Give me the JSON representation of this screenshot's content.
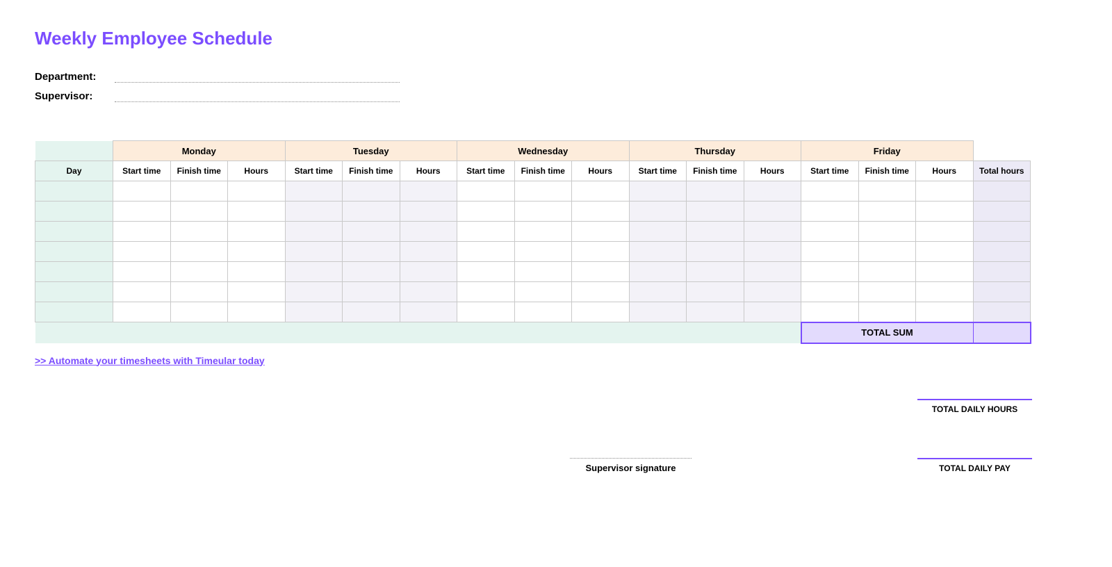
{
  "title": "Weekly Employee Schedule",
  "fields": {
    "department_label": "Department:",
    "supervisor_label": "Supervisor:",
    "department_value": "",
    "supervisor_value": ""
  },
  "table": {
    "day_header": "Day",
    "days": [
      "Monday",
      "Tuesday",
      "Wednesday",
      "Thursday",
      "Friday"
    ],
    "sub_headers": [
      "Start time",
      "Finish time",
      "Hours"
    ],
    "total_hours_header": "Total hours",
    "row_count": 7,
    "tinted_day_indices": [
      1,
      3
    ],
    "total_sum_label": "TOTAL SUM",
    "total_sum_value": ""
  },
  "link_text": ">> Automate your timesheets with Timeular today",
  "footer": {
    "signature_label": "Supervisor signature",
    "total_hours_label": "TOTAL DAILY HOURS",
    "total_pay_label": "TOTAL DAILY PAY"
  }
}
